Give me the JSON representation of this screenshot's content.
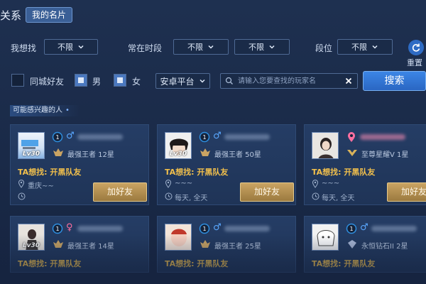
{
  "header": {
    "title": "关系",
    "tab_label": "我的名片"
  },
  "filters": {
    "seek_label": "我想找",
    "seek_value": "不限",
    "active_time_label": "常在时段",
    "active_time_from": "不限",
    "active_time_to": "不限",
    "rank_label": "段位",
    "rank_value": "不限",
    "reset_label": "重置"
  },
  "options": {
    "same_city_label": "同城好友",
    "male_label": "男",
    "female_label": "女",
    "platform_value": "安卓平台",
    "search_placeholder": "请输入您要查找的玩家名",
    "search_button": "搜索"
  },
  "section": {
    "label": "可能感兴趣的人"
  },
  "cards": [
    {
      "level": "Lv30",
      "gender": "♂",
      "gender_color": "#5aa8ff",
      "rank": "最强王者 12星",
      "seeking": "TA想找: 开黑队友",
      "location": "重庆~~",
      "time": "",
      "add_label": "加好友"
    },
    {
      "level": "Lv30",
      "gender": "♂",
      "gender_color": "#5aa8ff",
      "rank": "最强王者 50星",
      "seeking": "TA想找: 开黑队友",
      "location": "~~~",
      "time": "每天, 全天",
      "add_label": "加好友"
    },
    {
      "level": "",
      "gender": "♀",
      "gender_color": "#ff6fa0",
      "rank": "至尊星耀V 1星",
      "seeking": "TA想找: 开黑队友",
      "location": "~~~",
      "time": "每天, 全天",
      "add_label": "加好友"
    },
    {
      "level": "Lv30",
      "gender": "♀",
      "gender_color": "#ff6fa0",
      "rank": "最强王者 14星",
      "seeking": "TA想找: 开黑队友"
    },
    {
      "level": "",
      "gender": "♂",
      "gender_color": "#5aa8ff",
      "rank": "最强王者 25星",
      "seeking": "TA想找: 开黑队友"
    },
    {
      "level": "",
      "gender": "♂",
      "gender_color": "#5aa8ff",
      "rank": "永恒钻石II 2星",
      "seeking": "TA想找: 开黑队友"
    }
  ],
  "colors": {
    "accent_blue": "#3c86e6",
    "gold_button": "#caa463",
    "seek_text": "#f2c04c"
  }
}
